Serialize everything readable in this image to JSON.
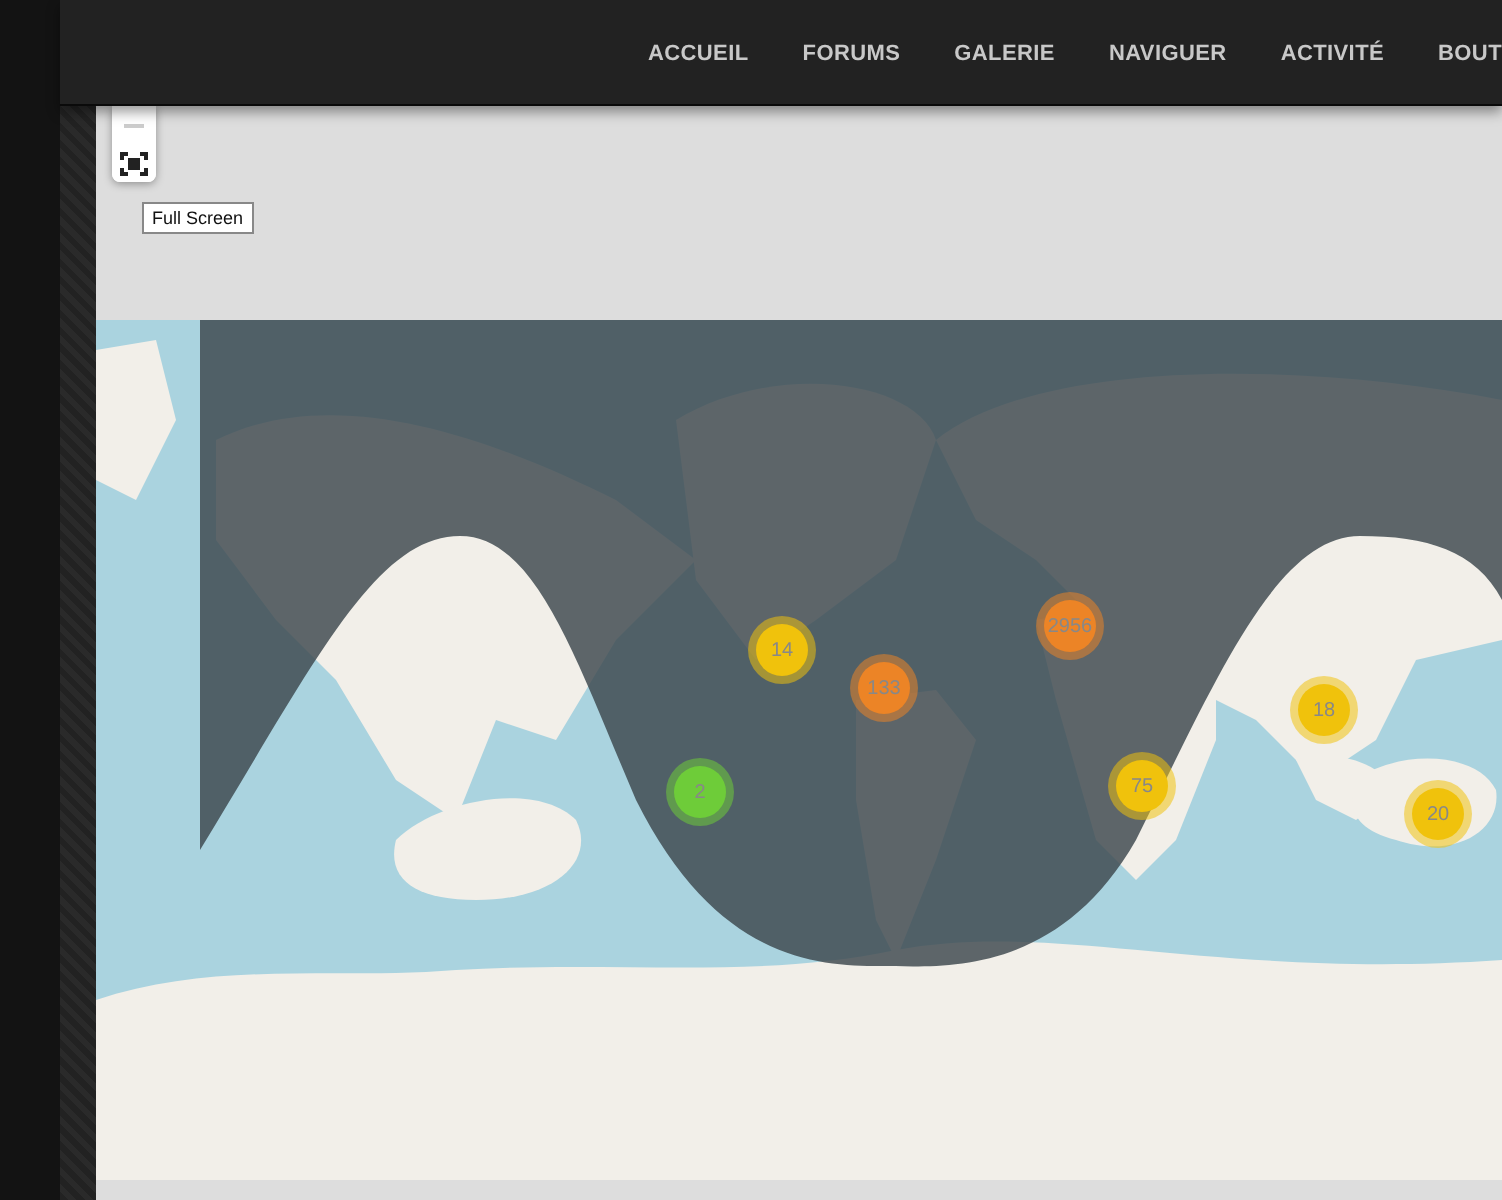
{
  "nav": {
    "items": [
      {
        "label": "ACCUEIL"
      },
      {
        "label": "FORUMS"
      },
      {
        "label": "GALERIE"
      },
      {
        "label": "NAVIGUER"
      },
      {
        "label": "ACTIVITÉ"
      },
      {
        "label": "BOUT"
      }
    ]
  },
  "map_controls": {
    "tooltip": "Full Screen"
  },
  "clusters": [
    {
      "count": "14",
      "color": "#f0c20c"
    },
    {
      "count": "133",
      "color": "#ec8426"
    },
    {
      "count": "2956",
      "color": "#ec8426"
    },
    {
      "count": "2",
      "color": "#6ecc39"
    },
    {
      "count": "75",
      "color": "#f0c20c"
    },
    {
      "count": "18",
      "color": "#f0c20c"
    },
    {
      "count": "20",
      "color": "#f0c20c"
    }
  ]
}
